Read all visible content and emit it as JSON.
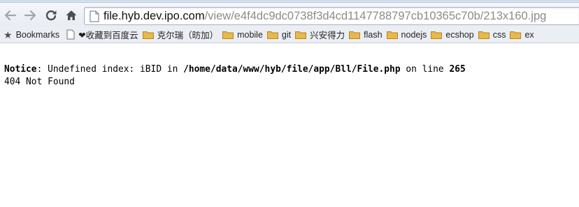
{
  "browser": {
    "address_bar": {
      "host": "file.hyb.dev.ipo.com",
      "path": "/view/e4f4dc9dc0738f3d4cd1147788797cb10365c70b/213x160.jpg"
    },
    "toolbar": {
      "back_icon": "back-arrow-icon",
      "forward_icon": "forward-arrow-icon",
      "reload_icon": "reload-icon",
      "home_icon": "home-icon"
    },
    "bookmarks": {
      "title": "Bookmarks",
      "items": [
        {
          "label": "❤收藏到百度云",
          "icon": "page-icon"
        },
        {
          "label": "克尔瑞（昉加）",
          "icon": "folder-icon"
        },
        {
          "label": "mobile",
          "icon": "folder-icon"
        },
        {
          "label": "git",
          "icon": "folder-icon"
        },
        {
          "label": "兴安得力",
          "icon": "folder-icon"
        },
        {
          "label": "flash",
          "icon": "folder-icon"
        },
        {
          "label": "nodejs",
          "icon": "folder-icon"
        },
        {
          "label": "ecshop",
          "icon": "folder-icon"
        },
        {
          "label": "css",
          "icon": "folder-icon"
        },
        {
          "label": "ex",
          "icon": "folder-icon"
        }
      ]
    }
  },
  "page": {
    "notice": {
      "label": "Notice",
      "colon": ":",
      "message_start": " Undefined index: iBID in ",
      "file": "/home/data/www/hyb/file/app/Bll/File.php",
      "message_mid": " on line ",
      "line": "265"
    },
    "status_text": "404 Not Found"
  },
  "colors": {
    "toolbar_bg": "#e8edf3",
    "bookmarks_bg": "#ebeff4",
    "url_host": "#111111",
    "url_path": "#8b8b8b",
    "folder": "#e8b84a"
  }
}
